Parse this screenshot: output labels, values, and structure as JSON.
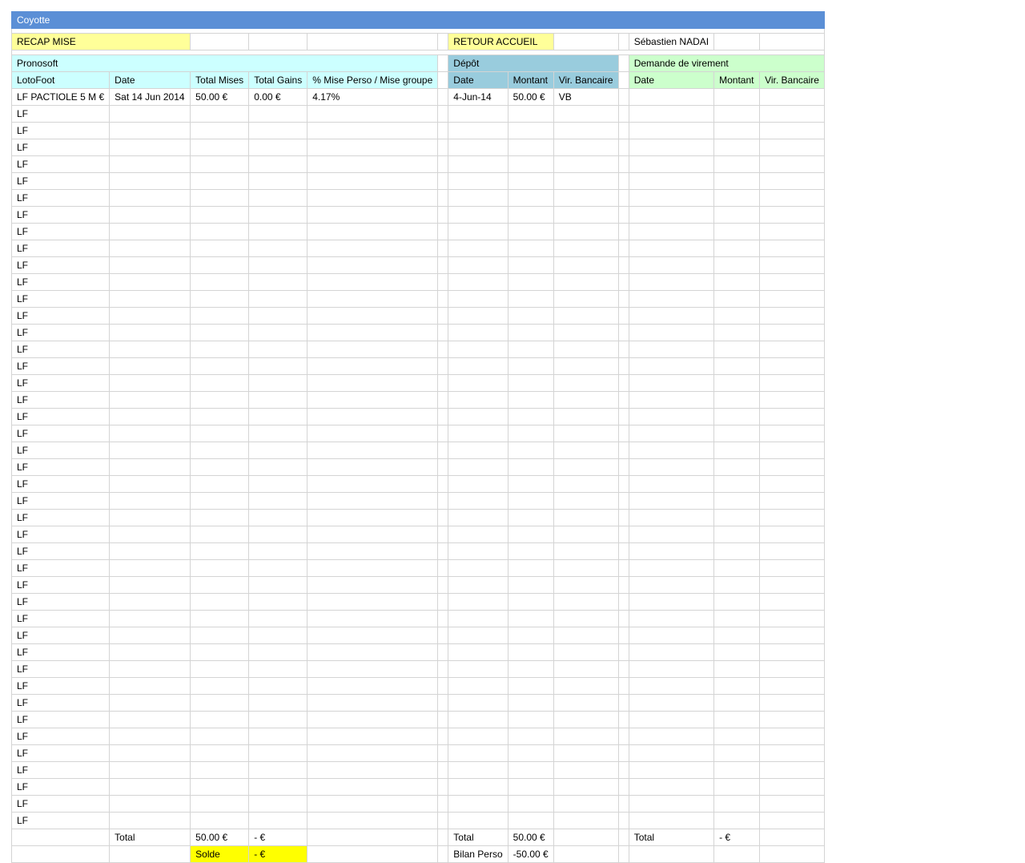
{
  "sheet": {
    "title": "Coyotte",
    "recap_button": "RECAP MISE",
    "home_button": "RETOUR ACCUEIL",
    "user_name": "Sébastien NADAI",
    "sections": {
      "pronosoft": "Pronosoft",
      "depot": "Dépôt",
      "virement": "Demande de virement"
    },
    "headers": {
      "lotofoot": "LotoFoot",
      "date": "Date",
      "total_mises": "Total Mises",
      "total_gains": "Total Gains",
      "pct": "% Mise Perso / Mise groupe",
      "depot_date": "Date",
      "depot_montant": "Montant",
      "depot_vir": "Vir. Bancaire",
      "vir_date": "Date",
      "vir_montant": "Montant",
      "vir_vir": "Vir. Bancaire"
    },
    "rows": [
      {
        "lf": "LF PACTIOLE 5 M €",
        "date": "Sat 14 Jun 2014",
        "mises": "50.00 €",
        "gains": "0.00 €",
        "pct": "4.17%",
        "d_date": "4-Jun-14",
        "d_montant": "50.00 €",
        "d_vir": "VB",
        "v_date": "",
        "v_montant": "",
        "v_vir": ""
      },
      {
        "lf": "LF",
        "date": "",
        "mises": "",
        "gains": "",
        "pct": "",
        "d_date": "",
        "d_montant": "",
        "d_vir": "",
        "v_date": "",
        "v_montant": "",
        "v_vir": ""
      },
      {
        "lf": "LF",
        "date": "",
        "mises": "",
        "gains": "",
        "pct": "",
        "d_date": "",
        "d_montant": "",
        "d_vir": "",
        "v_date": "",
        "v_montant": "",
        "v_vir": ""
      },
      {
        "lf": "LF",
        "date": "",
        "mises": "",
        "gains": "",
        "pct": "",
        "d_date": "",
        "d_montant": "",
        "d_vir": "",
        "v_date": "",
        "v_montant": "",
        "v_vir": ""
      },
      {
        "lf": "LF",
        "date": "",
        "mises": "",
        "gains": "",
        "pct": "",
        "d_date": "",
        "d_montant": "",
        "d_vir": "",
        "v_date": "",
        "v_montant": "",
        "v_vir": ""
      },
      {
        "lf": "LF",
        "date": "",
        "mises": "",
        "gains": "",
        "pct": "",
        "d_date": "",
        "d_montant": "",
        "d_vir": "",
        "v_date": "",
        "v_montant": "",
        "v_vir": ""
      },
      {
        "lf": "LF",
        "date": "",
        "mises": "",
        "gains": "",
        "pct": "",
        "d_date": "",
        "d_montant": "",
        "d_vir": "",
        "v_date": "",
        "v_montant": "",
        "v_vir": ""
      },
      {
        "lf": "LF",
        "date": "",
        "mises": "",
        "gains": "",
        "pct": "",
        "d_date": "",
        "d_montant": "",
        "d_vir": "",
        "v_date": "",
        "v_montant": "",
        "v_vir": ""
      },
      {
        "lf": "LF",
        "date": "",
        "mises": "",
        "gains": "",
        "pct": "",
        "d_date": "",
        "d_montant": "",
        "d_vir": "",
        "v_date": "",
        "v_montant": "",
        "v_vir": ""
      },
      {
        "lf": "LF",
        "date": "",
        "mises": "",
        "gains": "",
        "pct": "",
        "d_date": "",
        "d_montant": "",
        "d_vir": "",
        "v_date": "",
        "v_montant": "",
        "v_vir": ""
      },
      {
        "lf": "LF",
        "date": "",
        "mises": "",
        "gains": "",
        "pct": "",
        "d_date": "",
        "d_montant": "",
        "d_vir": "",
        "v_date": "",
        "v_montant": "",
        "v_vir": ""
      },
      {
        "lf": "LF",
        "date": "",
        "mises": "",
        "gains": "",
        "pct": "",
        "d_date": "",
        "d_montant": "",
        "d_vir": "",
        "v_date": "",
        "v_montant": "",
        "v_vir": ""
      },
      {
        "lf": "LF",
        "date": "",
        "mises": "",
        "gains": "",
        "pct": "",
        "d_date": "",
        "d_montant": "",
        "d_vir": "",
        "v_date": "",
        "v_montant": "",
        "v_vir": ""
      },
      {
        "lf": "LF",
        "date": "",
        "mises": "",
        "gains": "",
        "pct": "",
        "d_date": "",
        "d_montant": "",
        "d_vir": "",
        "v_date": "",
        "v_montant": "",
        "v_vir": ""
      },
      {
        "lf": "LF",
        "date": "",
        "mises": "",
        "gains": "",
        "pct": "",
        "d_date": "",
        "d_montant": "",
        "d_vir": "",
        "v_date": "",
        "v_montant": "",
        "v_vir": ""
      },
      {
        "lf": "LF",
        "date": "",
        "mises": "",
        "gains": "",
        "pct": "",
        "d_date": "",
        "d_montant": "",
        "d_vir": "",
        "v_date": "",
        "v_montant": "",
        "v_vir": ""
      },
      {
        "lf": "LF",
        "date": "",
        "mises": "",
        "gains": "",
        "pct": "",
        "d_date": "",
        "d_montant": "",
        "d_vir": "",
        "v_date": "",
        "v_montant": "",
        "v_vir": ""
      },
      {
        "lf": "LF",
        "date": "",
        "mises": "",
        "gains": "",
        "pct": "",
        "d_date": "",
        "d_montant": "",
        "d_vir": "",
        "v_date": "",
        "v_montant": "",
        "v_vir": ""
      },
      {
        "lf": "LF",
        "date": "",
        "mises": "",
        "gains": "",
        "pct": "",
        "d_date": "",
        "d_montant": "",
        "d_vir": "",
        "v_date": "",
        "v_montant": "",
        "v_vir": ""
      },
      {
        "lf": "LF",
        "date": "",
        "mises": "",
        "gains": "",
        "pct": "",
        "d_date": "",
        "d_montant": "",
        "d_vir": "",
        "v_date": "",
        "v_montant": "",
        "v_vir": ""
      },
      {
        "lf": "LF",
        "date": "",
        "mises": "",
        "gains": "",
        "pct": "",
        "d_date": "",
        "d_montant": "",
        "d_vir": "",
        "v_date": "",
        "v_montant": "",
        "v_vir": ""
      },
      {
        "lf": "LF",
        "date": "",
        "mises": "",
        "gains": "",
        "pct": "",
        "d_date": "",
        "d_montant": "",
        "d_vir": "",
        "v_date": "",
        "v_montant": "",
        "v_vir": ""
      },
      {
        "lf": "LF",
        "date": "",
        "mises": "",
        "gains": "",
        "pct": "",
        "d_date": "",
        "d_montant": "",
        "d_vir": "",
        "v_date": "",
        "v_montant": "",
        "v_vir": ""
      },
      {
        "lf": "LF",
        "date": "",
        "mises": "",
        "gains": "",
        "pct": "",
        "d_date": "",
        "d_montant": "",
        "d_vir": "",
        "v_date": "",
        "v_montant": "",
        "v_vir": ""
      },
      {
        "lf": "LF",
        "date": "",
        "mises": "",
        "gains": "",
        "pct": "",
        "d_date": "",
        "d_montant": "",
        "d_vir": "",
        "v_date": "",
        "v_montant": "",
        "v_vir": ""
      },
      {
        "lf": "LF",
        "date": "",
        "mises": "",
        "gains": "",
        "pct": "",
        "d_date": "",
        "d_montant": "",
        "d_vir": "",
        "v_date": "",
        "v_montant": "",
        "v_vir": ""
      },
      {
        "lf": "LF",
        "date": "",
        "mises": "",
        "gains": "",
        "pct": "",
        "d_date": "",
        "d_montant": "",
        "d_vir": "",
        "v_date": "",
        "v_montant": "",
        "v_vir": ""
      },
      {
        "lf": "LF",
        "date": "",
        "mises": "",
        "gains": "",
        "pct": "",
        "d_date": "",
        "d_montant": "",
        "d_vir": "",
        "v_date": "",
        "v_montant": "",
        "v_vir": ""
      },
      {
        "lf": "LF",
        "date": "",
        "mises": "",
        "gains": "",
        "pct": "",
        "d_date": "",
        "d_montant": "",
        "d_vir": "",
        "v_date": "",
        "v_montant": "",
        "v_vir": ""
      },
      {
        "lf": "LF",
        "date": "",
        "mises": "",
        "gains": "",
        "pct": "",
        "d_date": "",
        "d_montant": "",
        "d_vir": "",
        "v_date": "",
        "v_montant": "",
        "v_vir": ""
      },
      {
        "lf": "LF",
        "date": "",
        "mises": "",
        "gains": "",
        "pct": "",
        "d_date": "",
        "d_montant": "",
        "d_vir": "",
        "v_date": "",
        "v_montant": "",
        "v_vir": ""
      },
      {
        "lf": "LF",
        "date": "",
        "mises": "",
        "gains": "",
        "pct": "",
        "d_date": "",
        "d_montant": "",
        "d_vir": "",
        "v_date": "",
        "v_montant": "",
        "v_vir": ""
      },
      {
        "lf": "LF",
        "date": "",
        "mises": "",
        "gains": "",
        "pct": "",
        "d_date": "",
        "d_montant": "",
        "d_vir": "",
        "v_date": "",
        "v_montant": "",
        "v_vir": ""
      },
      {
        "lf": "LF",
        "date": "",
        "mises": "",
        "gains": "",
        "pct": "",
        "d_date": "",
        "d_montant": "",
        "d_vir": "",
        "v_date": "",
        "v_montant": "",
        "v_vir": ""
      },
      {
        "lf": "LF",
        "date": "",
        "mises": "",
        "gains": "",
        "pct": "",
        "d_date": "",
        "d_montant": "",
        "d_vir": "",
        "v_date": "",
        "v_montant": "",
        "v_vir": ""
      },
      {
        "lf": "LF",
        "date": "",
        "mises": "",
        "gains": "",
        "pct": "",
        "d_date": "",
        "d_montant": "",
        "d_vir": "",
        "v_date": "",
        "v_montant": "",
        "v_vir": ""
      },
      {
        "lf": "LF",
        "date": "",
        "mises": "",
        "gains": "",
        "pct": "",
        "d_date": "",
        "d_montant": "",
        "d_vir": "",
        "v_date": "",
        "v_montant": "",
        "v_vir": ""
      },
      {
        "lf": "LF",
        "date": "",
        "mises": "",
        "gains": "",
        "pct": "",
        "d_date": "",
        "d_montant": "",
        "d_vir": "",
        "v_date": "",
        "v_montant": "",
        "v_vir": ""
      },
      {
        "lf": "LF",
        "date": "",
        "mises": "",
        "gains": "",
        "pct": "",
        "d_date": "",
        "d_montant": "",
        "d_vir": "",
        "v_date": "",
        "v_montant": "",
        "v_vir": ""
      },
      {
        "lf": "LF",
        "date": "",
        "mises": "",
        "gains": "",
        "pct": "",
        "d_date": "",
        "d_montant": "",
        "d_vir": "",
        "v_date": "",
        "v_montant": "",
        "v_vir": ""
      },
      {
        "lf": "LF",
        "date": "",
        "mises": "",
        "gains": "",
        "pct": "",
        "d_date": "",
        "d_montant": "",
        "d_vir": "",
        "v_date": "",
        "v_montant": "",
        "v_vir": ""
      },
      {
        "lf": "LF",
        "date": "",
        "mises": "",
        "gains": "",
        "pct": "",
        "d_date": "",
        "d_montant": "",
        "d_vir": "",
        "v_date": "",
        "v_montant": "",
        "v_vir": ""
      },
      {
        "lf": "LF",
        "date": "",
        "mises": "",
        "gains": "",
        "pct": "",
        "d_date": "",
        "d_montant": "",
        "d_vir": "",
        "v_date": "",
        "v_montant": "",
        "v_vir": ""
      },
      {
        "lf": "LF",
        "date": "",
        "mises": "",
        "gains": "",
        "pct": "",
        "d_date": "",
        "d_montant": "",
        "d_vir": "",
        "v_date": "",
        "v_montant": "",
        "v_vir": ""
      }
    ],
    "totals": {
      "label": "Total",
      "mises": "50.00 €",
      "gains": "- €",
      "depot_label": "Total",
      "depot_montant": "50.00 €",
      "vir_label": "Total",
      "vir_montant": "- €"
    },
    "balance": {
      "solde_label": "Solde",
      "solde_value": "- €",
      "bilan_label": "Bilan Perso",
      "bilan_value": "-50.00 €"
    }
  }
}
